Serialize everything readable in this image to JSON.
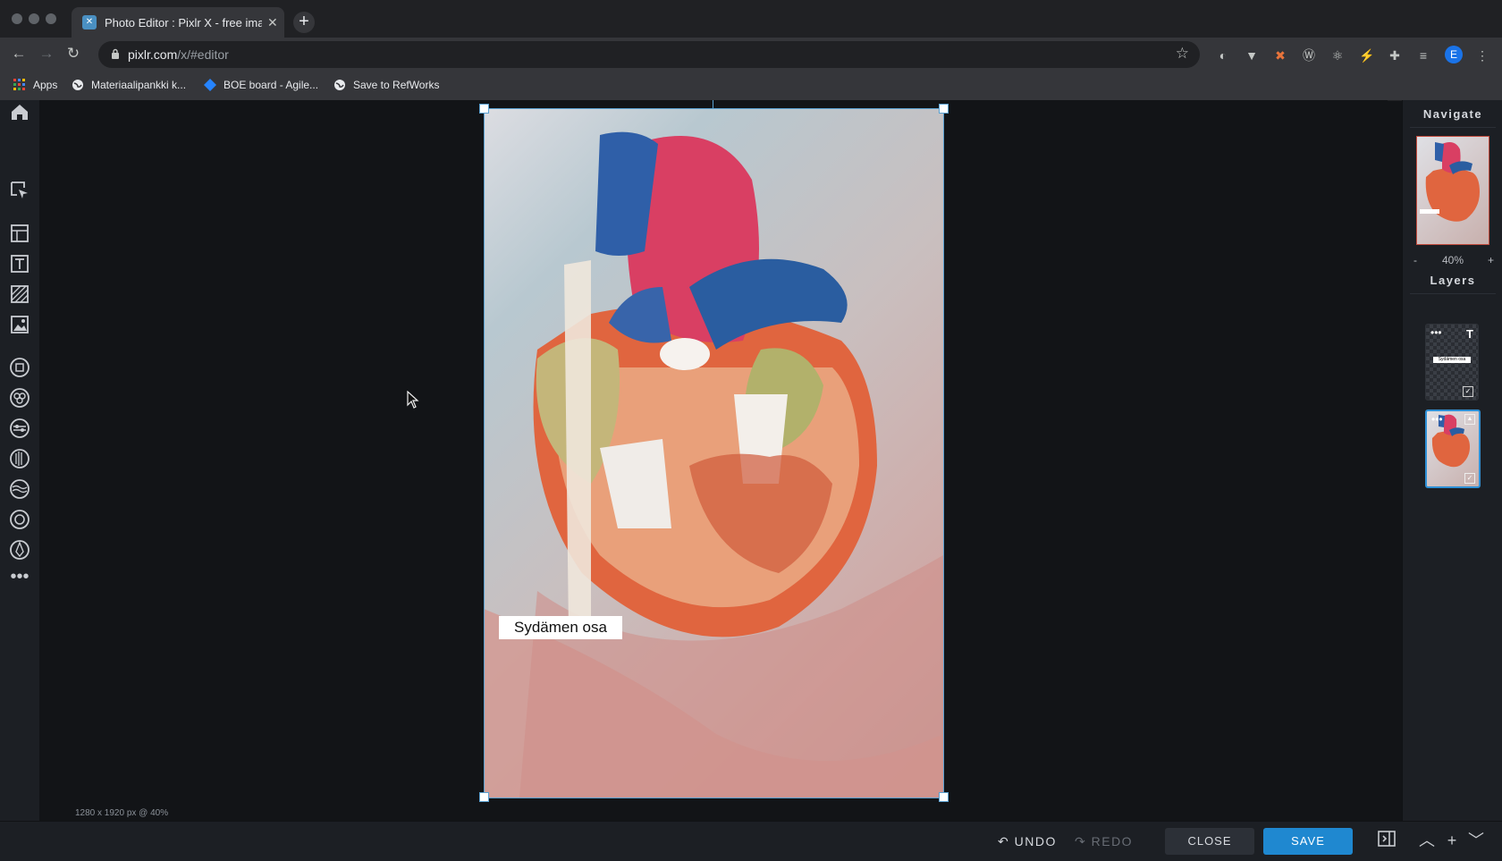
{
  "browser": {
    "tab_title": "Photo Editor : Pixlr X - free ima",
    "tab_close": "✕",
    "new_tab": "+",
    "url_domain": "pixlr.com",
    "url_path": "/x/#editor",
    "bookmarks": [
      {
        "label": "Apps"
      },
      {
        "label": "Materiaalipankki k..."
      },
      {
        "label": "BOE board - Agile..."
      },
      {
        "label": "Save to RefWorks"
      }
    ],
    "profile_initial": "E"
  },
  "editor": {
    "text_layer_content": "Sydämen osa",
    "status": "1280 x 1920 px @ 40%",
    "navigate_title": "Navigate",
    "zoom_minus": "-",
    "zoom_value": "40%",
    "zoom_plus": "+",
    "layers_title": "Layers",
    "text_layer_thumb_label": "Sydämen osa",
    "undo_label": "UNDO",
    "redo_label": "REDO",
    "close_label": "CLOSE",
    "save_label": "SAVE"
  },
  "colors": {
    "accent": "#1f88d0",
    "panel": "#1c1f24",
    "canvas_bg": "#121417"
  }
}
